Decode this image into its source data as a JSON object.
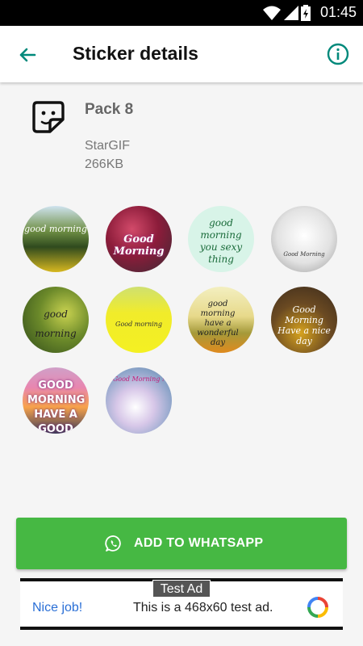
{
  "status": {
    "time": "01:45"
  },
  "appbar": {
    "title": "Sticker details"
  },
  "pack": {
    "name": "Pack 8",
    "publisher": "StarGIF",
    "size": "266KB"
  },
  "stickers": [
    {
      "caption": "good morning"
    },
    {
      "caption": "Good Morning"
    },
    {
      "caption": "good morning you sexy thing"
    },
    {
      "caption": "Good Morning"
    },
    {
      "caption": "good morning"
    },
    {
      "caption": "Good morning"
    },
    {
      "caption": "good morning have a wonderful day"
    },
    {
      "caption": "Good Morning Have a nice day"
    },
    {
      "caption": "GOOD MORNING HAVE A GOOD DAY"
    },
    {
      "caption": "Good Morning !"
    }
  ],
  "add_button": {
    "label": "ADD TO WHATSAPP"
  },
  "ad": {
    "tag": "Test Ad",
    "nice": "Nice job!",
    "text": "This is a 468x60 test ad."
  },
  "colors": {
    "accent": "#00897b",
    "whatsapp_green": "#46b843"
  }
}
